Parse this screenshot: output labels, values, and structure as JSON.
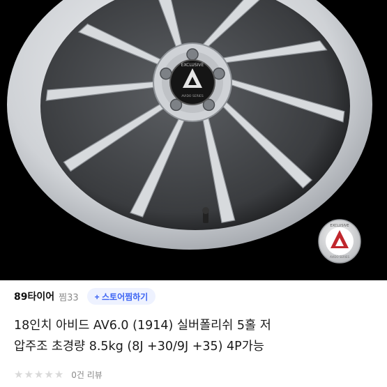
{
  "product": {
    "hub_logo_text": "EXCLUSIVE",
    "hub_series_text": "AVIDO SERIES",
    "badge_logo_text": "EXCLUSIVE",
    "badge_series_text": "AVIDO SERIES"
  },
  "store": {
    "name": "89타이어",
    "zzim_label": "찜33",
    "follow_label": "+ 스토어찜하기"
  },
  "title": {
    "line1": "18인치 아비드 AV6.0 (1914) 실버폴리쉬 5홀 저",
    "line2": "압주조 초경량 8.5kg (8J +30/9J +35) 4P가능"
  },
  "review": {
    "stars_filled": 0,
    "stars_total": 5,
    "count_label": "0건 리뷰"
  },
  "colors": {
    "accent": "#3b63f3",
    "accent_bg": "#eef2ff",
    "star_empty": "#d9d9d9"
  },
  "icons": [
    "star-icon"
  ]
}
